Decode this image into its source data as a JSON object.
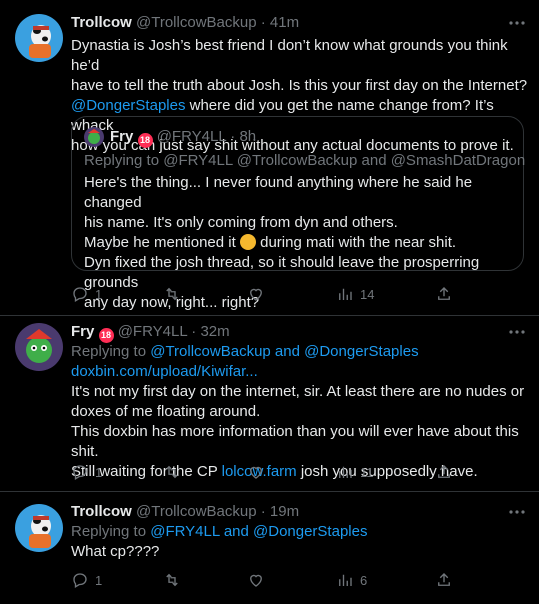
{
  "tweets": [
    {
      "name": "Trollcow",
      "handle": "@TrollcowBackup",
      "time": "· 41m",
      "more": "···",
      "text_lines": [
        "Dynastia is Josh’s best friend I don’t know what grounds you think he’d",
        "have to tell the truth about Josh. Is this your first day on the Internet?"
      ],
      "mention": "@DongerStaples",
      "text_after_mention": " where did you get the name change from? It’s whack",
      "text_last": "how you can just say shit without any actual documents to prove it.",
      "quote": {
        "name": "Fry",
        "badge": "18",
        "handle": "@FRY4LL",
        "time": "· 8h",
        "replying": "Replying to @FRY4LL @TrollcowBackup and @SmashDatDragon",
        "lines": [
          "Here's the thing... I never found anything where he said he changed",
          "his name. It's only coming from dyn and others.",
          "Maybe he mentioned it",
          "during mati with the near shit.",
          "Dyn fixed the josh thread, so it should leave the prosperring grounds",
          "any day now, right... right?"
        ]
      },
      "actions": {
        "replies": "1",
        "retweets": "",
        "likes": "",
        "views": "14"
      }
    },
    {
      "name": "Fry",
      "badge": "18",
      "handle": "@FRY4LL",
      "time": "· 32m",
      "more": "···",
      "replying_prefix": "Replying to ",
      "replying_to": "@TrollcowBackup and @DongerStaples",
      "link": "doxbin.com/upload/Kiwifar...",
      "lines": [
        "It's not my first day on the internet, sir. At least there are no nudes or",
        "doxes of me floating around.",
        "This doxbin has more information than you will ever have about this shit."
      ],
      "last_prefix": "Still waiting for the CP ",
      "last_link": "lolcow.farm",
      "last_suffix": " josh you supposedly have.",
      "actions": {
        "replies": "1",
        "retweets": "",
        "likes": "",
        "views": "11"
      }
    },
    {
      "name": "Trollcow",
      "handle": "@TrollcowBackup",
      "time": "· 19m",
      "more": "···",
      "replying_prefix": "Replying to ",
      "replying_to": "@FRY4LL and @DongerStaples",
      "text": "What cp????",
      "actions": {
        "replies": "1",
        "retweets": "",
        "likes": "",
        "views": "6"
      }
    }
  ],
  "colors": {
    "background": "#000000",
    "text": "#e7e9ea",
    "muted": "#71767b",
    "link": "#1d9bf0",
    "divider": "#2f3336"
  }
}
